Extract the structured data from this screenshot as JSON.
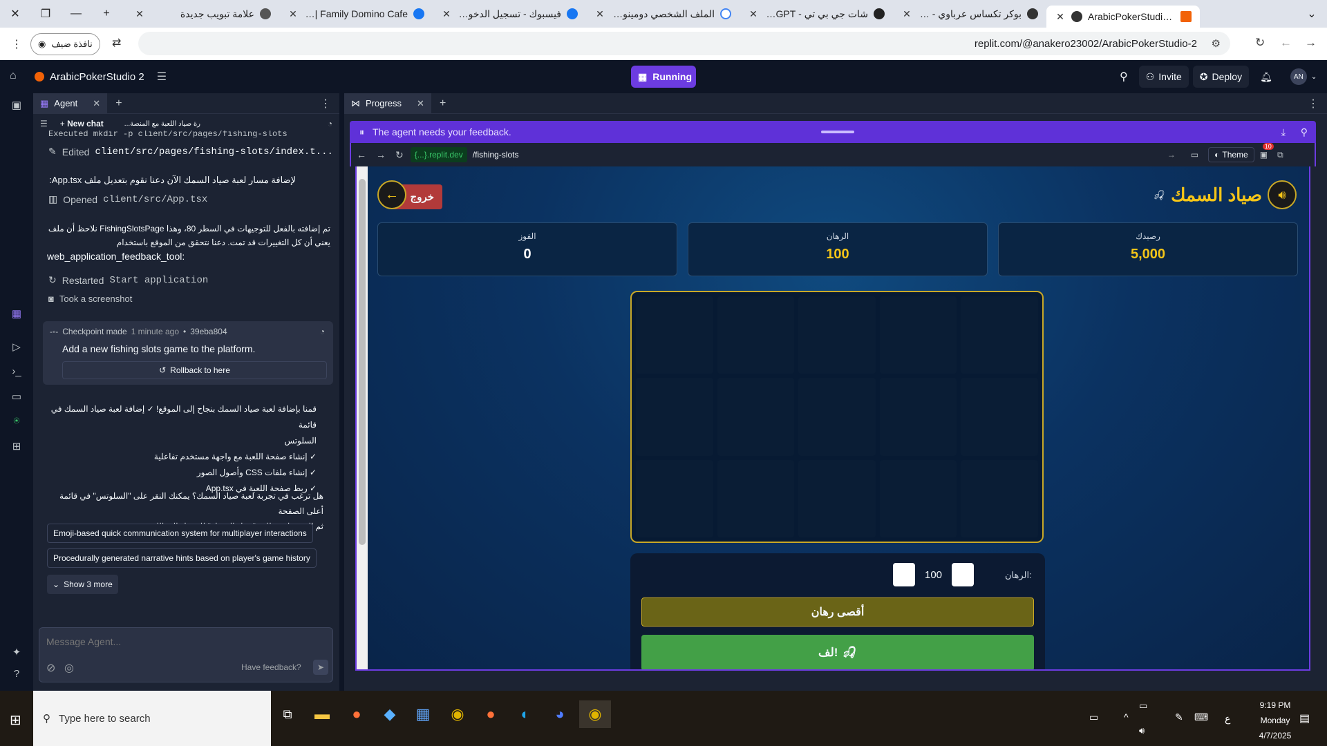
{
  "browser": {
    "tabs": [
      {
        "title": "ArabicPokerStudio 2 - Replit",
        "active": true
      },
      {
        "title": "بوكر تكساس عرباوي - لعبة البوكر"
      },
      {
        "title": "شات جي بي تي - ChatGPT"
      },
      {
        "title": "الملف الشخصي دومينو كافيه - ch"
      },
      {
        "title": "فيسبوك - تسجيل الدخول أو الاشتراك"
      },
      {
        "title": "Family Domino Cafe | دومينو كافيه"
      },
      {
        "title": "علامة تبويب جديدة"
      }
    ],
    "guest_label": "نافذة ضيف",
    "url": "replit.com/@anakero23002/ArabicPokerStudio-2"
  },
  "replit": {
    "project_name": "ArabicPokerStudio 2",
    "run_label": "Running",
    "invite_label": "Invite",
    "deploy_label": "Deploy",
    "avatar": "AN"
  },
  "agent": {
    "tab_label": "Agent",
    "new_chat": "New chat",
    "chat_title": "...رة صياد اللعبة مع المنصة",
    "truncated_tool": "Executed mkdir -p client/src/pages/fishing-slots",
    "tool_edited": "Edited",
    "tool_edited_path": "client/src/pages/fishing-slots/index.t...",
    "msg1": "لإضافة مسار لعبة صياد السمك الآن دعنا نقوم بتعديل ملف App.tsx:",
    "tool_opened": "Opened",
    "tool_opened_path": "client/src/App.tsx",
    "msg2_line1": "تم إضافته بالفعل للتوجيهات في السطر 80، وهذا FishingSlotsPage نلاحظ أن ملف",
    "msg2_line2": "يعني أن كل التغييرات قد تمت. دعنا نتحقق من الموقع باستخدام",
    "msg2_line3": "web_application_feedback_tool:",
    "tool_restarted": "Restarted",
    "tool_restarted_name": "Start application",
    "tool_screenshot": "Took a screenshot",
    "checkpoint_label": "Checkpoint made",
    "checkpoint_time": "1 minute ago",
    "checkpoint_hash": "39eba804",
    "checkpoint_desc": "Add a new fishing slots game to the platform.",
    "rollback_label": "Rollback to here",
    "summary": [
      "قمنا بإضافة لعبة صياد السمك بنجاح إلى الموقع! ✓ إضافة لعبة صياد السمك في قائمة",
      "السلوتس",
      "✓ إنشاء صفحة اللعبة مع واجهة مستخدم تفاعلية",
      "✓ إنشاء ملفات CSS وأصول الصور",
      "✓ ربط صفحة اللعبة في App.tsx"
    ],
    "question": [
      "هل ترغب في تجربة لعبة صياد السمك؟ يمكنك النقر على \"السلوتس\" في قائمة أعلى الصفحة",
      "ثم النقر على بطاقة \"صياد السمك\" للدخول إلى اللعبة."
    ],
    "suggestions": [
      "Emoji-based quick communication system for multiplayer interactions",
      "Procedurally generated narrative hints based on player's game history"
    ],
    "show_more": "Show 3 more",
    "input_placeholder": "Message Agent...",
    "have_feedback": "Have feedback?"
  },
  "preview": {
    "tab_label": "Progress",
    "feedback_text": "The agent needs your feedback.",
    "domain": "{...}.replit.dev",
    "path": "/fishing-slots",
    "theme_label": "Theme",
    "notif_count": "10"
  },
  "game": {
    "title": "صياد السمك",
    "exit_label": "خروج",
    "stats": [
      {
        "label": "رصيدك",
        "value": "5,000",
        "color": "#f5c518"
      },
      {
        "label": "الرهان",
        "value": "100",
        "color": "#f5c518"
      },
      {
        "label": "الفوز",
        "value": "0",
        "color": "#ffffff"
      }
    ],
    "bet_label": "الرهان:",
    "bet_value": "100",
    "max_bet_label": "أقصى رهان",
    "spin_label": "لف!"
  },
  "taskbar": {
    "search_placeholder": "Type here to search",
    "time": "9:19 PM",
    "day": "Monday",
    "date": "4/7/2025",
    "lang": "ع"
  }
}
